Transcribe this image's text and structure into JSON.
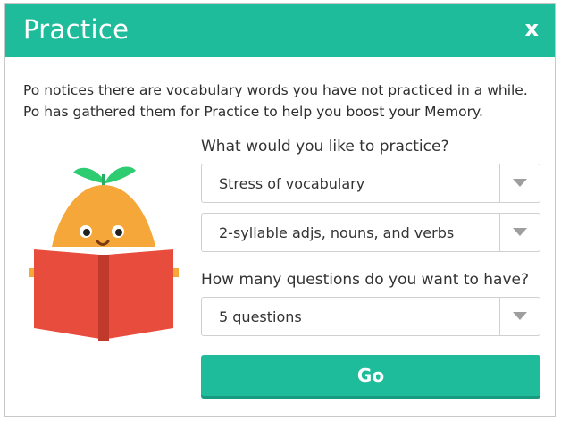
{
  "dialog": {
    "title": "Practice",
    "close_label": "x",
    "intro": "Po notices there are vocabulary words you have not practiced in a while. Po has gathered them for Practice to help you boost your Memory."
  },
  "form": {
    "practice_label": "What would you like to practice?",
    "practice_type": "Stress of vocabulary",
    "practice_set": "2-syllable adjs, nouns, and verbs",
    "questions_label": "How many questions do you want to have?",
    "questions_count": "5 questions",
    "go_label": "Go"
  },
  "colors": {
    "accent": "#1fbc9c",
    "book": "#e84c3d",
    "character": "#f6a73a",
    "leaf": "#2ecc71"
  }
}
